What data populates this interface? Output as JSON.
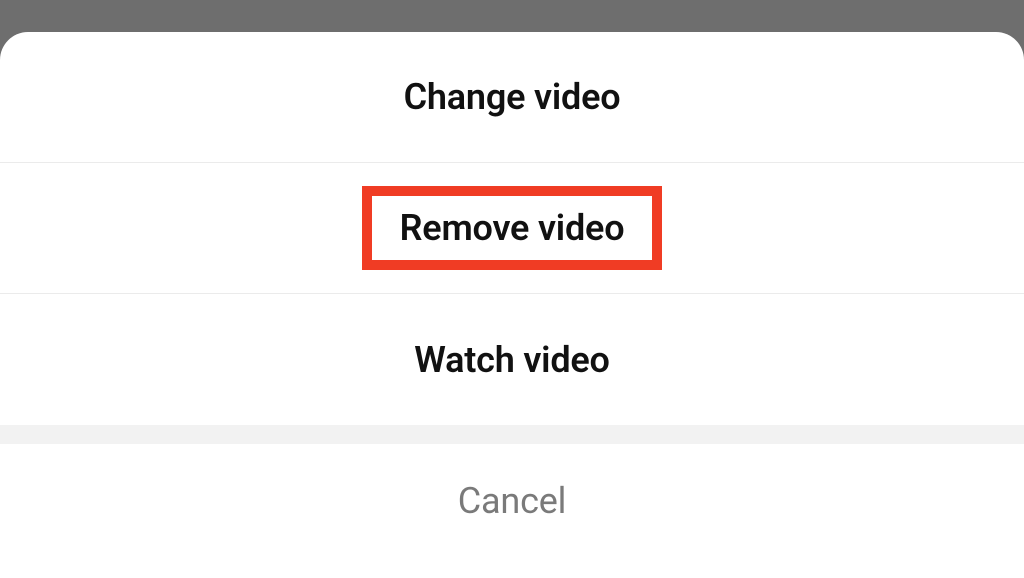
{
  "sheet": {
    "options": [
      {
        "label": "Change video"
      },
      {
        "label": "Remove video"
      },
      {
        "label": "Watch video"
      }
    ],
    "cancel_label": "Cancel"
  },
  "highlight": {
    "color": "#f03c24",
    "target_index": 1
  }
}
